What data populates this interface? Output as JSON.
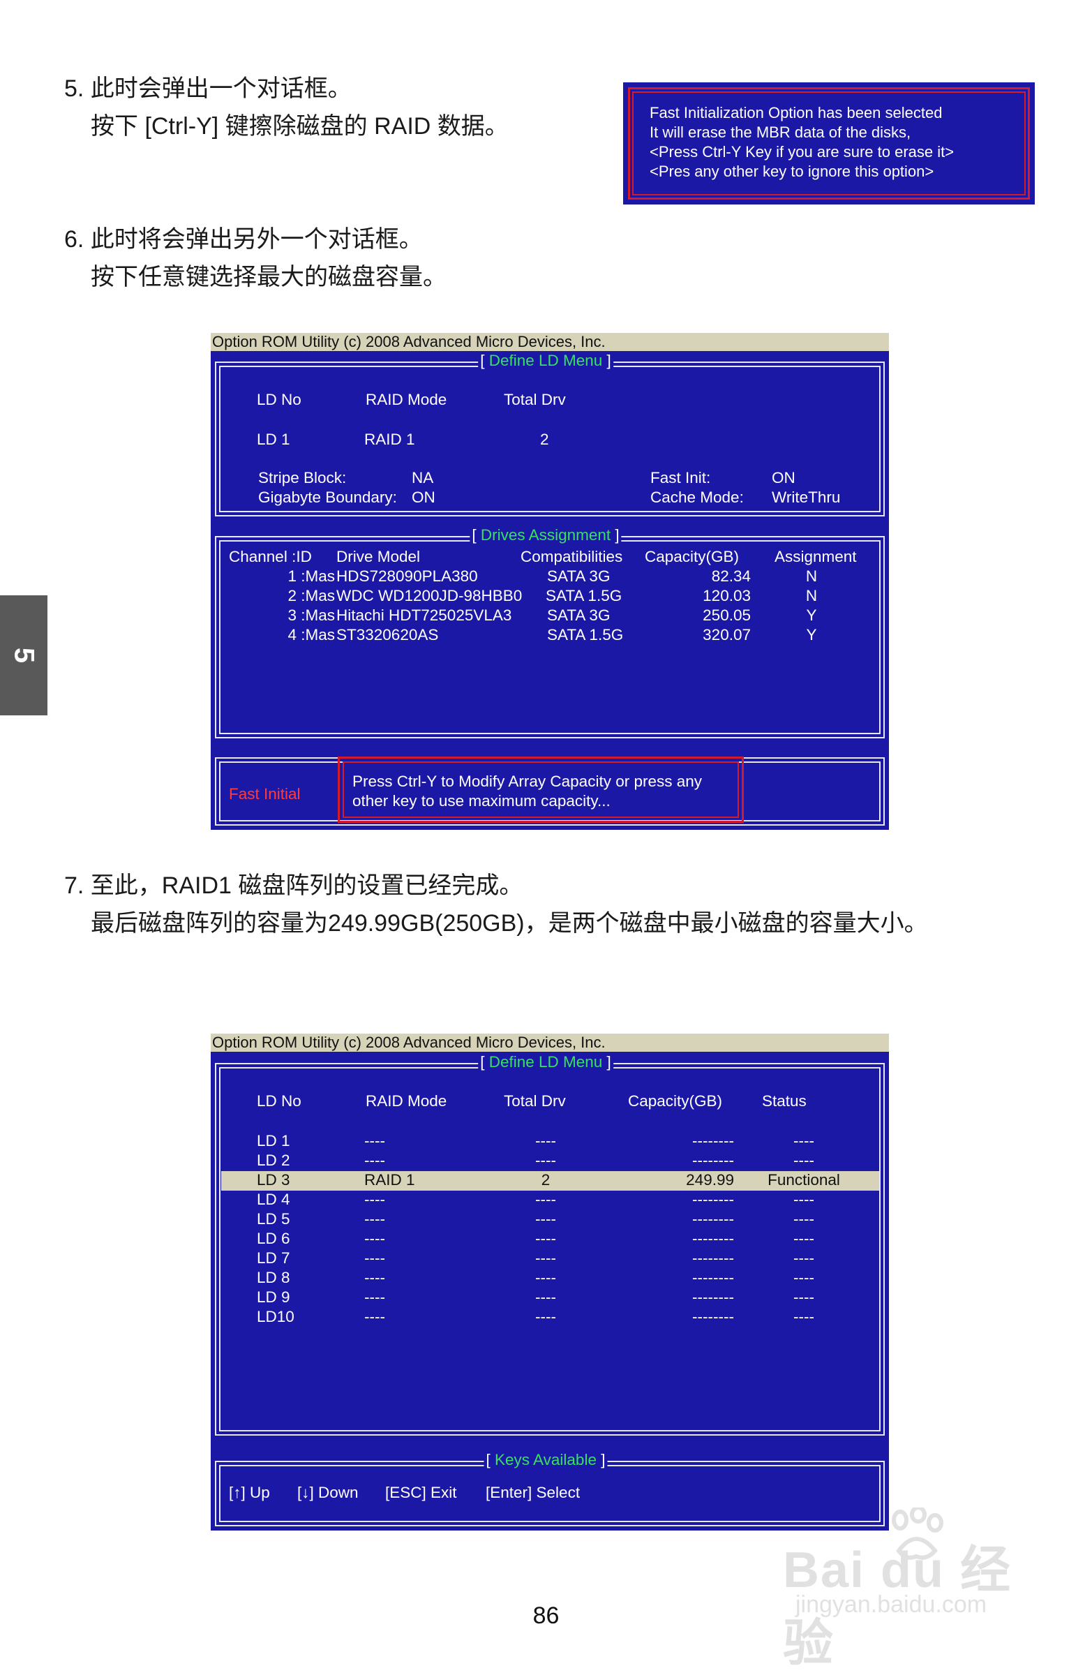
{
  "side_tab": "5",
  "step5": {
    "line1": "5. 此时会弹出一个对话框。",
    "line2": "按下  [Ctrl-Y] 键擦除磁盘的 RAID 数据。"
  },
  "dialog": {
    "lines": [
      "Fast Initialization Option has been selected",
      "It will erase the MBR data of the disks,",
      "<Press Ctrl-Y Key if you are sure to erase it>",
      "<Pres any other key to ignore this option>"
    ]
  },
  "step6": {
    "line1": "6. 此时将会弹出另外一个对话框。",
    "line2": "按下任意键选择最大的磁盘容量。"
  },
  "screen1": {
    "title": "Option ROM Utility (c) 2008 Advanced Micro Devices, Inc.",
    "define_legend": "Define LD Menu",
    "headers": {
      "ld_no": "LD No",
      "raid_mode": "RAID Mode",
      "total_drv": "Total Drv"
    },
    "ld": {
      "no": "LD  1",
      "mode": "RAID 1",
      "drv": "2"
    },
    "stripe_label": "Stripe Block:",
    "stripe_value": "NA",
    "gb_label": "Gigabyte Boundary:",
    "gb_value": "ON",
    "fast_init_label": "Fast Init:",
    "fast_init_value": "ON",
    "cache_label": "Cache Mode:",
    "cache_value": "WriteThru",
    "drives_legend": "Drives Assignment",
    "drive_headers": {
      "channel": "Channel  :ID",
      "model": "Drive Model",
      "compat": "Compatibilities",
      "capacity": "Capacity(GB)",
      "assign": "Assignment"
    },
    "drives": [
      {
        "id": "1 :Mas",
        "model": "HDS728090PLA380",
        "compat": "SATA  3G",
        "capacity": "82.34",
        "assign": "N"
      },
      {
        "id": "2 :Mas",
        "model": "WDC WD1200JD-98HBB0",
        "compat": "SATA  1.5G",
        "capacity": "120.03",
        "assign": "N"
      },
      {
        "id": "3 :Mas",
        "model": "Hitachi HDT725025VLA3",
        "compat": "SATA  3G",
        "capacity": "250.05",
        "assign": "Y"
      },
      {
        "id": "4 :Mas",
        "model": "ST3320620AS",
        "compat": "SATA  1.5G",
        "capacity": "320.07",
        "assign": "Y"
      }
    ],
    "fast_initial": "Fast Initial",
    "message_line1": "Press Ctrl-Y to Modify Array Capacity or press any",
    "message_line2": "other key to use maximum capacity..."
  },
  "step7": {
    "line1": "7. 至此，RAID1 磁盘阵列的设置已经完成。",
    "line2": "最后磁盘阵列的容量为249.99GB(250GB)，是两个磁盘中最小磁盘的容量大小。"
  },
  "screen2": {
    "title": "Option ROM Utility (c) 2008 Advanced Micro Devices, Inc.",
    "define_legend": "Define LD Menu",
    "headers": {
      "ld_no": "LD No",
      "raid_mode": "RAID Mode",
      "total_drv": "Total Drv",
      "capacity": "Capacity(GB)",
      "status": "Status"
    },
    "rows": [
      {
        "no": "LD  1",
        "mode": "----",
        "drv": "----",
        "cap": "--------",
        "status": "----"
      },
      {
        "no": "LD  2",
        "mode": "----",
        "drv": "----",
        "cap": "--------",
        "status": "----"
      },
      {
        "no": "LD  3",
        "mode": "RAID 1",
        "drv": "2",
        "cap": "249.99",
        "status": "Functional"
      },
      {
        "no": "LD  4",
        "mode": "----",
        "drv": "----",
        "cap": "--------",
        "status": "----"
      },
      {
        "no": "LD  5",
        "mode": "----",
        "drv": "----",
        "cap": "--------",
        "status": "----"
      },
      {
        "no": "LD  6",
        "mode": "----",
        "drv": "----",
        "cap": "--------",
        "status": "----"
      },
      {
        "no": "LD  7",
        "mode": "----",
        "drv": "----",
        "cap": "--------",
        "status": "----"
      },
      {
        "no": "LD  8",
        "mode": "----",
        "drv": "----",
        "cap": "--------",
        "status": "----"
      },
      {
        "no": "LD  9",
        "mode": "----",
        "drv": "----",
        "cap": "--------",
        "status": "----"
      },
      {
        "no": "LD10",
        "mode": "----",
        "drv": "----",
        "cap": "--------",
        "status": "----"
      }
    ],
    "keys_legend": "Keys Available",
    "keys": {
      "up": "[↑] Up",
      "down": "[↓] Down",
      "esc": "[ESC] Exit",
      "enter": "[Enter] Select"
    }
  },
  "page_number": "86",
  "watermark": {
    "brand": "Bai du 经验",
    "url": "jingyan.baidu.com"
  }
}
